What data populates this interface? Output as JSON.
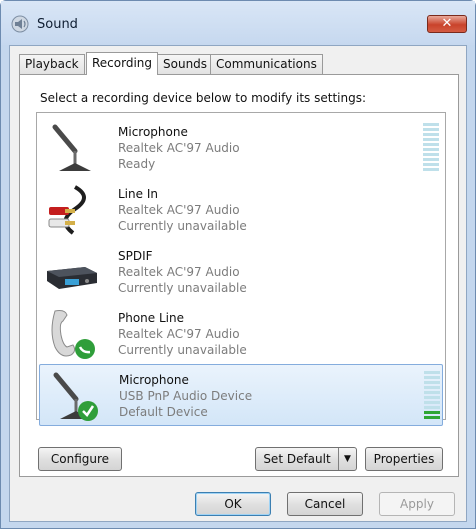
{
  "window": {
    "title": "Sound",
    "close_glyph": "✕"
  },
  "tabs": [
    {
      "label": "Playback"
    },
    {
      "label": "Recording"
    },
    {
      "label": "Sounds"
    },
    {
      "label": "Communications"
    }
  ],
  "active_tab": "Recording",
  "instructions": "Select a recording device below to modify its settings:",
  "devices": [
    {
      "name": "Microphone",
      "driver": "Realtek AC'97 Audio",
      "status": "Ready",
      "icon": "microphone-icon",
      "meter_level": 0
    },
    {
      "name": "Line In",
      "driver": "Realtek AC'97 Audio",
      "status": "Currently unavailable",
      "icon": "line-in-cable-icon"
    },
    {
      "name": "SPDIF",
      "driver": "Realtek AC'97 Audio",
      "status": "Currently unavailable",
      "icon": "spdif-device-icon"
    },
    {
      "name": "Phone Line",
      "driver": "Realtek AC'97 Audio",
      "status": "Currently unavailable",
      "icon": "phone-icon"
    },
    {
      "name": "Microphone",
      "driver": "USB PnP Audio Device",
      "status": "Default Device",
      "icon": "microphone-default-icon",
      "meter_level": 0.2,
      "selected": true
    }
  ],
  "buttons": {
    "configure": "Configure",
    "set_default": "Set Default",
    "properties": "Properties",
    "ok": "OK",
    "cancel": "Cancel",
    "apply": "Apply"
  },
  "colors": {
    "selection": "#d3e6f8",
    "meter_on": "#2fa534",
    "meter_off": "#bfe0ea",
    "close_button": "#c9432b"
  }
}
